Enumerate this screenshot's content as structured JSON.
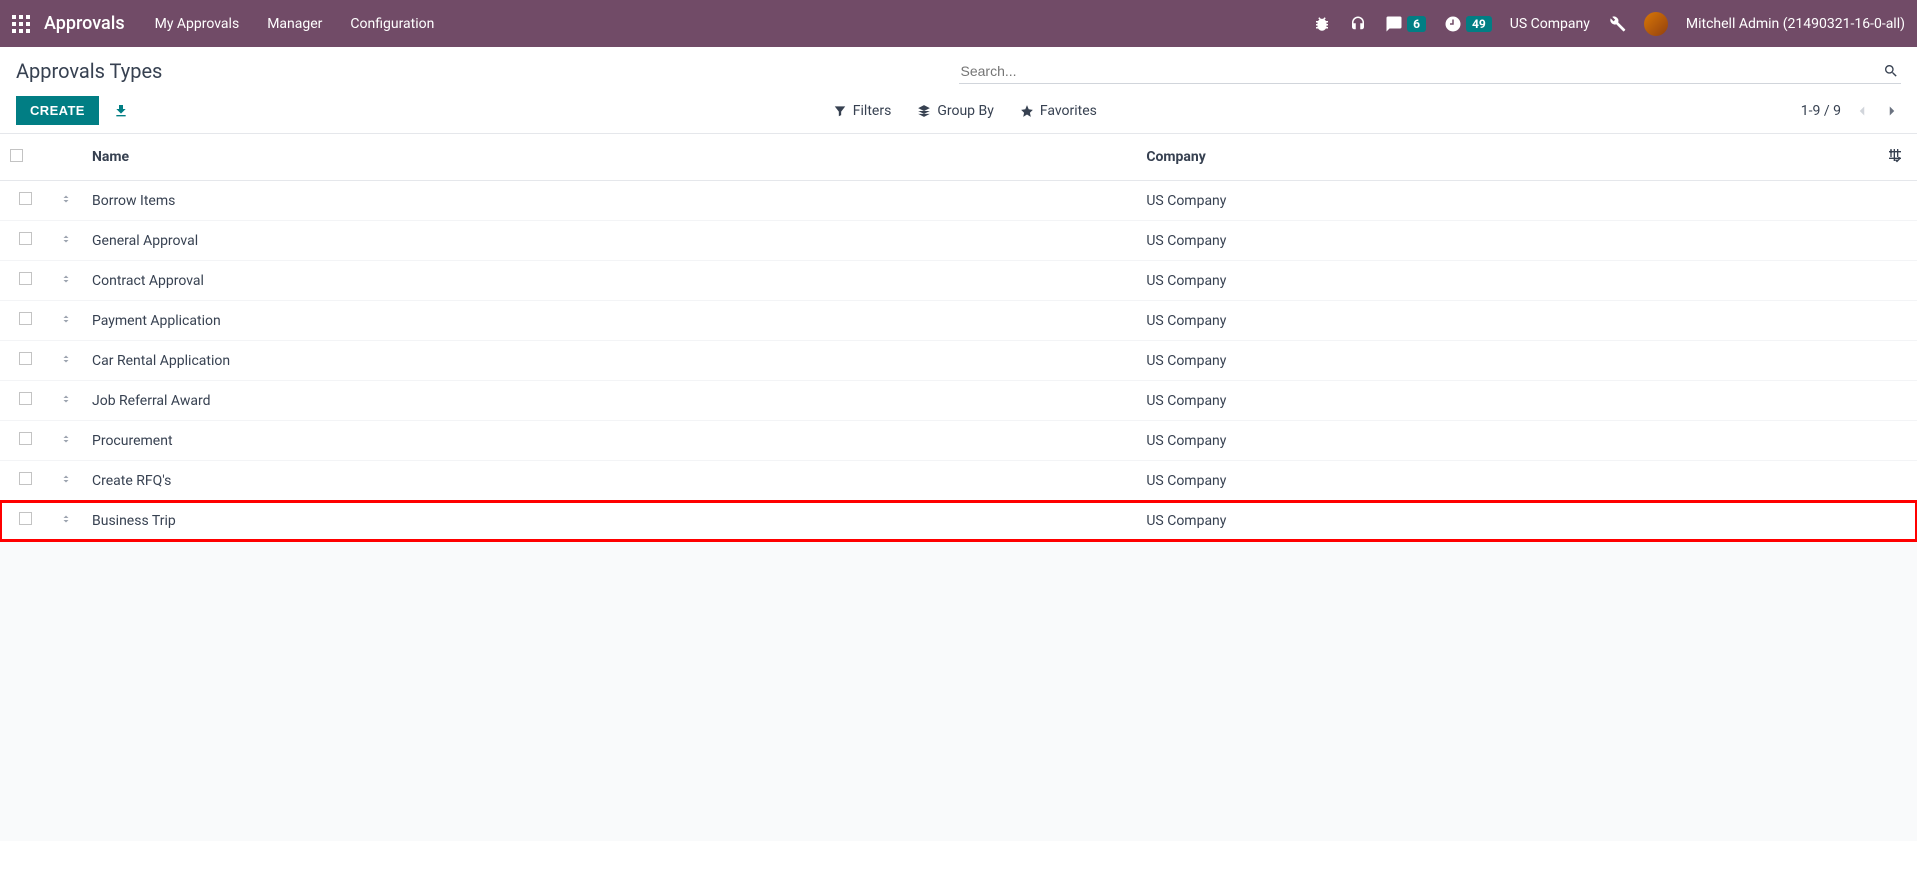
{
  "nav": {
    "app_title": "Approvals",
    "items": [
      "My Approvals",
      "Manager",
      "Configuration"
    ],
    "messages_badge": "6",
    "activities_badge": "49",
    "company": "US Company",
    "user": "Mitchell Admin (21490321-16-0-all)"
  },
  "cp": {
    "breadcrumb": "Approvals Types",
    "search_placeholder": "Search...",
    "create_label": "CREATE",
    "filters_label": "Filters",
    "groupby_label": "Group By",
    "favorites_label": "Favorites",
    "pager": "1-9 / 9"
  },
  "table": {
    "col_name": "Name",
    "col_company": "Company",
    "rows": [
      {
        "name": "Borrow Items",
        "company": "US Company"
      },
      {
        "name": "General Approval",
        "company": "US Company"
      },
      {
        "name": "Contract Approval",
        "company": "US Company"
      },
      {
        "name": "Payment Application",
        "company": "US Company"
      },
      {
        "name": "Car Rental Application",
        "company": "US Company"
      },
      {
        "name": "Job Referral Award",
        "company": "US Company"
      },
      {
        "name": "Procurement",
        "company": "US Company"
      },
      {
        "name": "Create RFQ's",
        "company": "US Company"
      },
      {
        "name": "Business Trip",
        "company": "US Company"
      }
    ],
    "highlight_index": 8
  }
}
